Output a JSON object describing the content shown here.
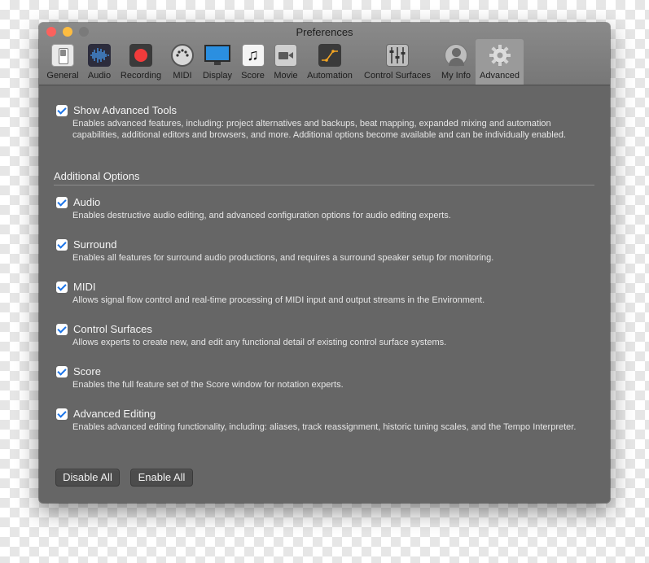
{
  "window": {
    "title": "Preferences"
  },
  "toolbar": {
    "tabs": [
      {
        "label": "General",
        "icon": "general-switch-icon"
      },
      {
        "label": "Audio",
        "icon": "waveform-icon"
      },
      {
        "label": "Recording",
        "icon": "record-icon"
      },
      {
        "label": "MIDI",
        "icon": "midi-connector-icon"
      },
      {
        "label": "Display",
        "icon": "monitor-icon"
      },
      {
        "label": "Score",
        "icon": "music-note-icon"
      },
      {
        "label": "Movie",
        "icon": "video-camera-icon"
      },
      {
        "label": "Automation",
        "icon": "automation-curve-icon"
      },
      {
        "label": "Control Surfaces",
        "icon": "fader-icon"
      },
      {
        "label": "My Info",
        "icon": "user-icon"
      },
      {
        "label": "Advanced",
        "icon": "gear-icon"
      }
    ],
    "active_tab": "Advanced"
  },
  "main": {
    "show_advanced": {
      "checked": true,
      "label": "Show Advanced Tools",
      "description": "Enables advanced features, including: project alternatives and backups, beat mapping, expanded mixing and automation capabilities, additional editors and browsers, and more. Additional options become available and can be individually enabled."
    },
    "section_title": "Additional Options",
    "options": [
      {
        "checked": true,
        "label": "Audio",
        "description": "Enables destructive audio editing, and advanced configuration options for audio editing experts."
      },
      {
        "checked": true,
        "label": "Surround",
        "description": "Enables all features for surround audio productions, and requires a surround speaker setup for monitoring."
      },
      {
        "checked": true,
        "label": "MIDI",
        "description": "Allows signal flow control and real-time processing of MIDI input and output streams in the Environment."
      },
      {
        "checked": true,
        "label": "Control Surfaces",
        "description": "Allows experts to create new, and edit any functional detail of existing control surface systems."
      },
      {
        "checked": true,
        "label": "Score",
        "description": "Enables the full feature set of the Score window for notation experts."
      },
      {
        "checked": true,
        "label": "Advanced Editing",
        "description": "Enables advanced editing functionality, including: aliases, track reassignment, historic tuning scales, and the Tempo Interpreter."
      }
    ],
    "buttons": {
      "disable_all": "Disable All",
      "enable_all": "Enable All"
    }
  },
  "colors": {
    "window_bg": "#666666",
    "checkbox_check": "#1b74e8",
    "close": "#fc615d",
    "minimize": "#fdbc40"
  }
}
